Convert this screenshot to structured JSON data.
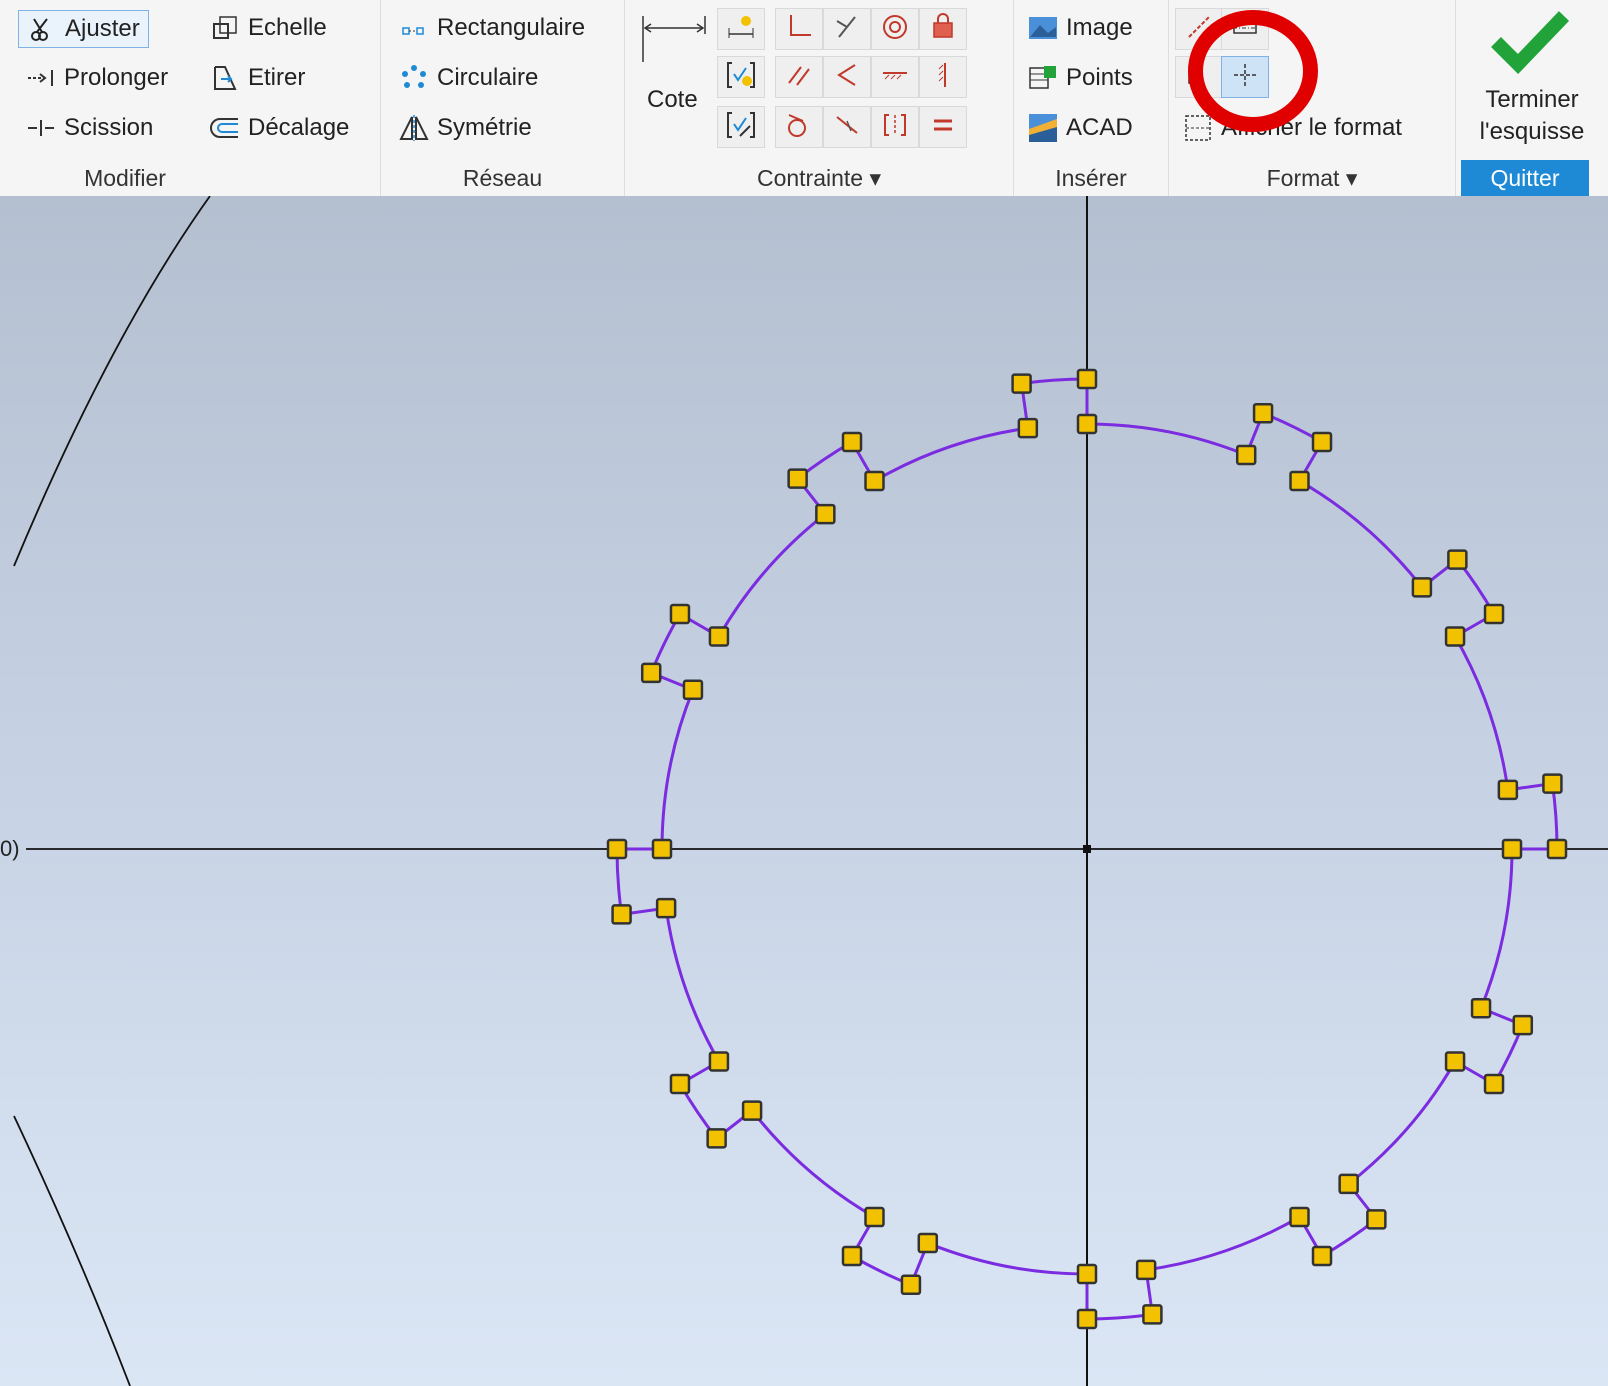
{
  "ribbon": {
    "modifier": {
      "label": "Modifier",
      "ajuster": "Ajuster",
      "prolonger": "Prolonger",
      "scission": "Scission",
      "echelle": "Echelle",
      "etirer": "Etirer",
      "decalage": "Décalage"
    },
    "reseau": {
      "label": "Réseau",
      "rectangulaire": "Rectangulaire",
      "circulaire": "Circulaire",
      "symetrie": "Symétrie"
    },
    "cote": {
      "label": "Cote"
    },
    "contrainte": {
      "label": "Contrainte ▾"
    },
    "inserer": {
      "label": "Insérer",
      "image": "Image",
      "points": "Points",
      "acad": "ACAD"
    },
    "format": {
      "label": "Format ▾",
      "afficher": "Afficher le format"
    },
    "quitter": {
      "terminer_line1": "Terminer",
      "terminer_line2": "l'esquisse",
      "label": "Quitter"
    }
  },
  "annotation": {
    "color": "#e00000"
  },
  "sketch": {
    "profile_color": "#7b2be0",
    "point_fill": "#f2c200",
    "axis_color": "#111111",
    "axis_label": "0)",
    "profile": {
      "outer_radius": 470,
      "inner_radius": 425,
      "tooth_count": 12
    }
  },
  "colors": {
    "accent": "#1e8ad6",
    "check": "#21a33a",
    "constraint_red": "#c0392b"
  }
}
